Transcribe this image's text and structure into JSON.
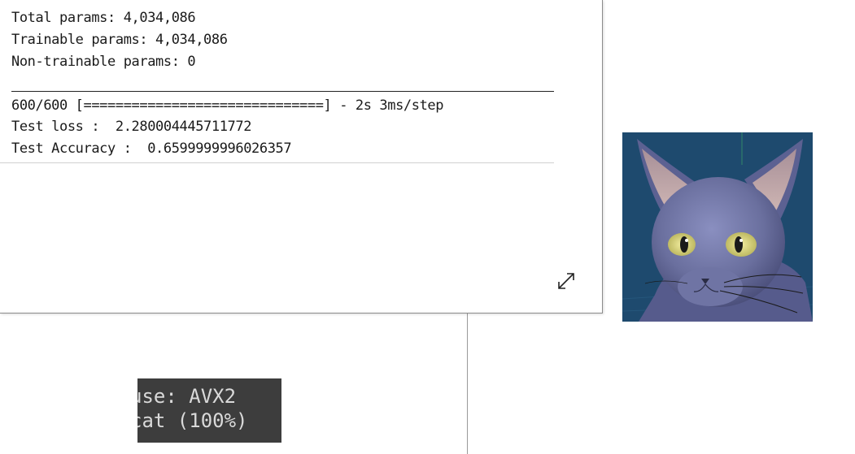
{
  "output": {
    "lines_top": [
      "Total params: 4,034,086",
      "Trainable params: 4,034,086",
      "Non-trainable params: 0"
    ],
    "progress_line": "600/600 [==============================] - 2s 3ms/step",
    "test_loss_line": "Test loss :  2.280004445711772",
    "test_accuracy_line": "Test Accuracy :  0.6599999996026357"
  },
  "console": {
    "line1": "use: AVX2",
    "line2": "cat (100%)"
  },
  "icons": {
    "expand": "expand-diagonal-icon"
  },
  "colors": {
    "console_bg": "#3d3d3d",
    "console_text": "#d9d9d9",
    "cat_bg": "#1e4a6e",
    "cat_fur": "#6a6f9e"
  }
}
